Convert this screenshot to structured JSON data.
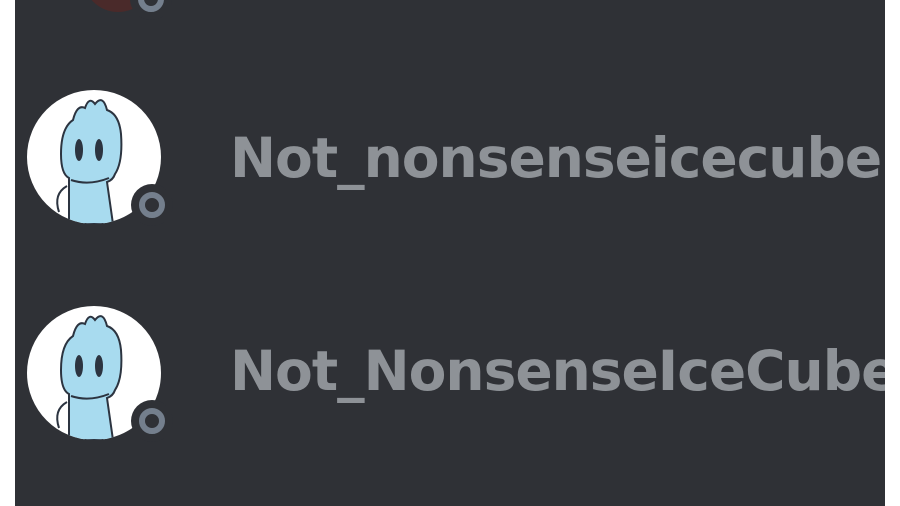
{
  "members": [
    {
      "username": "Not_nonsenseicecube",
      "status": "offline",
      "avatar_icon": "ice-cube-character-icon"
    },
    {
      "username": "Not_NonsenseIceCube",
      "status": "offline",
      "avatar_icon": "ice-cube-character-icon"
    }
  ],
  "colors": {
    "background": "#2f3136",
    "username_text": "#8e9297",
    "status_offline": "#747f8d",
    "avatar_character": "#a8dbef"
  }
}
